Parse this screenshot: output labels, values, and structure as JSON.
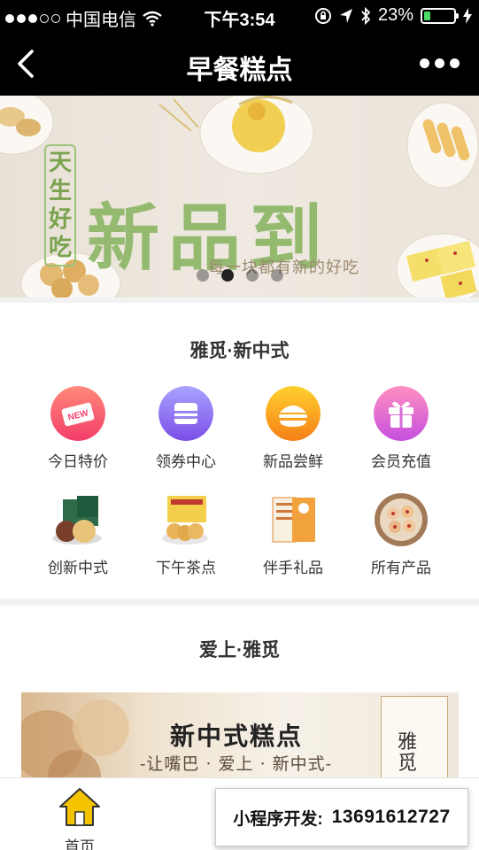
{
  "status_bar": {
    "carrier": "中国电信",
    "time": "下午3:54",
    "battery_percent": "23%",
    "battery_level": 0.23
  },
  "nav": {
    "title": "早餐糕点",
    "back_icon": "chevron-left-icon",
    "more_icon": "more-dots-icon"
  },
  "banner": {
    "headline": "新品到",
    "side_text": "天生好吃",
    "tagline": "每一块都有新的好吃",
    "pager_count": 4,
    "pager_active": 1
  },
  "section1": {
    "title": "雅觅·新中式",
    "items": [
      {
        "label": "今日特价",
        "icon": "new-tag-icon",
        "color": "#f24d6b"
      },
      {
        "label": "领券中心",
        "icon": "coupon-icon",
        "color": "#7b6cf0"
      },
      {
        "label": "新品尝鲜",
        "icon": "burger-icon",
        "color": "#f7a21b"
      },
      {
        "label": "会员充值",
        "icon": "gift-icon",
        "color": "#e65fd2"
      },
      {
        "label": "创新中式",
        "icon": "mooncake-box-image",
        "color": "#7c5a44"
      },
      {
        "label": "下午茶点",
        "icon": "pastry-box-image",
        "color": "#e6a23a"
      },
      {
        "label": "伴手礼品",
        "icon": "gift-box-image",
        "color": "#e27c2f"
      },
      {
        "label": "所有产品",
        "icon": "cookie-plate-image",
        "color": "#c98a5c"
      }
    ]
  },
  "section2": {
    "title": "爱上·雅觅",
    "promo_title": "新中式糕点",
    "promo_subtitle": "-让嘴巴 · 爱上 · 新中式-",
    "promo_badge": "雅觅"
  },
  "tabbar": {
    "home_label": "首页",
    "home_icon": "home-icon",
    "home_color": "#f5c400"
  },
  "ad": {
    "label": "小程序开发:",
    "phone": "13691612727"
  }
}
